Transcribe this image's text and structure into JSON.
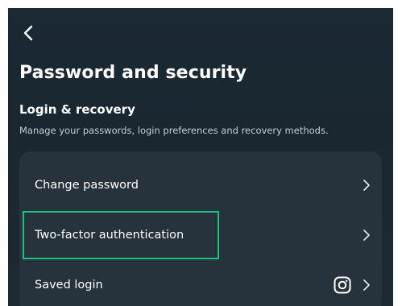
{
  "header": {
    "back_icon": "chevron-left-icon",
    "title": "Password and security"
  },
  "section": {
    "title": "Login & recovery",
    "description": "Manage your passwords, login preferences and recovery methods."
  },
  "items": [
    {
      "label": "Change password",
      "trailing_icon": "chevron-right-icon"
    },
    {
      "label": "Two-factor authentication",
      "trailing_icon": "chevron-right-icon",
      "highlighted": true
    },
    {
      "label": "Saved login",
      "app_icon": "instagram-icon",
      "trailing_icon": "chevron-right-icon"
    }
  ],
  "colors": {
    "background": "#1b2934",
    "card": "#26333d",
    "text": "#ffffff",
    "subtext": "#c4ccd3",
    "highlight": "#19c37d"
  }
}
